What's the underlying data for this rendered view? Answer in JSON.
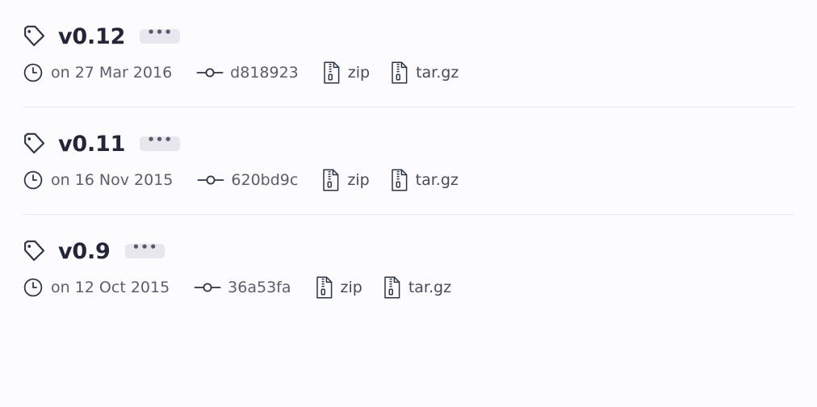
{
  "page": {
    "background_color": "#fcfbfd",
    "divider_color": "#e6e6ec",
    "heading_color": "#24243a",
    "meta_color": "#5d5d6d",
    "badge_background": "#e7e7ed"
  },
  "releases": [
    {
      "tag_icon": "tag-icon",
      "version": "v0.12",
      "menu_label": "•••",
      "clock_icon": "clock-icon",
      "date": "on 27 Mar 2016",
      "commit_icon": "git-commit-icon",
      "commit": "d818923",
      "zip_icon": "file-zip-icon",
      "zip_label": "zip",
      "targz_icon": "file-zip-icon",
      "targz_label": "tar.gz"
    },
    {
      "tag_icon": "tag-icon",
      "version": "v0.11",
      "menu_label": "•••",
      "clock_icon": "clock-icon",
      "date": "on 16 Nov 2015",
      "commit_icon": "git-commit-icon",
      "commit": "620bd9c",
      "zip_icon": "file-zip-icon",
      "zip_label": "zip",
      "targz_icon": "file-zip-icon",
      "targz_label": "tar.gz"
    },
    {
      "tag_icon": "tag-icon",
      "version": "v0.9",
      "menu_label": "•••",
      "clock_icon": "clock-icon",
      "date": "on 12 Oct 2015",
      "commit_icon": "git-commit-icon",
      "commit": "36a53fa",
      "zip_icon": "file-zip-icon",
      "zip_label": "zip",
      "targz_icon": "file-zip-icon",
      "targz_label": "tar.gz"
    }
  ]
}
